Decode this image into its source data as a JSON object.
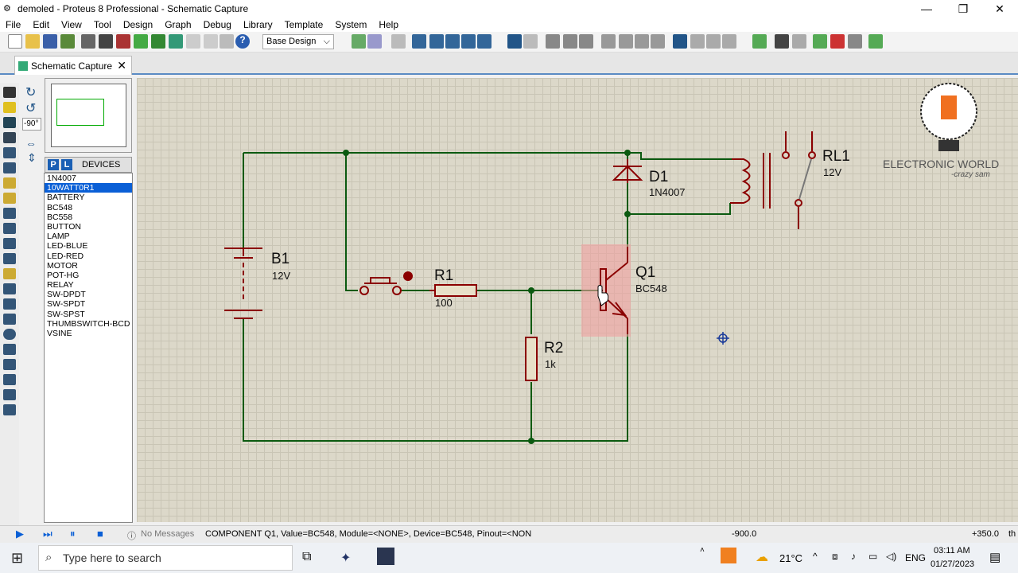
{
  "window": {
    "title": "demoled - Proteus 8 Professional - Schematic Capture"
  },
  "menu": [
    "File",
    "Edit",
    "View",
    "Tool",
    "Design",
    "Graph",
    "Debug",
    "Library",
    "Template",
    "System",
    "Help"
  ],
  "toolbar": {
    "design_select": "Base Design"
  },
  "tab": {
    "label": "Schematic Capture"
  },
  "angle": "-90°",
  "devices": {
    "header": "DEVICES",
    "p": "P",
    "l": "L",
    "selected_index": 1,
    "items": [
      "1N4007",
      "10WATT0R1",
      "BATTERY",
      "BC548",
      "BC558",
      "BUTTON",
      "LAMP",
      "LED-BLUE",
      "LED-RED",
      "MOTOR",
      "POT-HG",
      "RELAY",
      "SW-DPDT",
      "SW-SPDT",
      "SW-SPST",
      "THUMBSWITCH-BCD",
      "VSINE"
    ]
  },
  "schematic": {
    "b1": {
      "ref": "B1",
      "value": "12V"
    },
    "r1": {
      "ref": "R1",
      "value": "100"
    },
    "r2": {
      "ref": "R2",
      "value": "1k"
    },
    "q1": {
      "ref": "Q1",
      "value": "BC548"
    },
    "d1": {
      "ref": "D1",
      "value": "1N4007"
    },
    "rl1": {
      "ref": "RL1",
      "value": "12V"
    },
    "watermark_line1": "ELECTRONIC WORLD",
    "watermark_line2": "-crazy sam"
  },
  "status": {
    "messages": "No Messages",
    "info": "COMPONENT Q1, Value=BC548, Module=<NONE>, Device=BC548, Pinout=<NON",
    "x": "-900.0",
    "y": "+350.0",
    "th": "th"
  },
  "taskbar": {
    "search_placeholder": "Type here to search",
    "temp": "21°C",
    "lang": "ENG",
    "time": "03:11 AM",
    "date": "01/27/2023"
  },
  "colors": {
    "wire": "#0b5a10",
    "component": "#8b0000",
    "selection": "#f0a0a0"
  }
}
